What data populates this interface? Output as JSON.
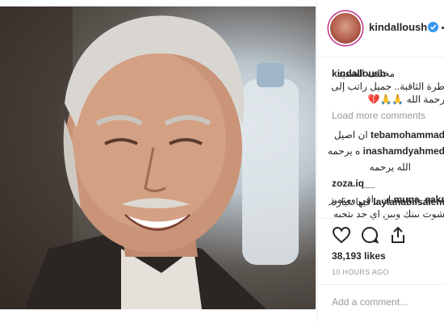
{
  "post": {
    "username": "kindalloush",
    "caption": {
      "user": "kindalloush",
      "line1": "مختلف الشديد",
      "line2": "طرة الثاقبة.. جميل راتب إلى",
      "line3": "رحمة الله 🙏🙏💔"
    },
    "load_more": "Load more comments",
    "comments": [
      {
        "user": "tebamohammad",
        "text": "ان اصيل"
      },
      {
        "user": "inashamdyahmed",
        "text": "ه يرحمه"
      },
      {
        "user": "",
        "text": "الله يرحمه"
      },
      {
        "user": "zoza.iq__",
        "text": ""
      },
      {
        "user": "muna_sakr",
        "text": "ان راقي ومتميز"
      },
      {
        "user": "laylanabilsalem",
        "text": "فيها عبارة"
      },
      {
        "user": "",
        "text": "شوت بينك وبين اي حد بتحبه"
      }
    ],
    "likes": "38,193 likes",
    "time_ago": "10 HOURS AGO",
    "add_comment_placeholder": "Add a comment..."
  },
  "icons": [
    "heart-icon",
    "comment-icon",
    "share-icon",
    "verified-badge-icon",
    "more-options-icon"
  ],
  "colors": {
    "verified": "#3897f0",
    "muted": "#999999",
    "text": "#262626",
    "border": "#efefef"
  }
}
